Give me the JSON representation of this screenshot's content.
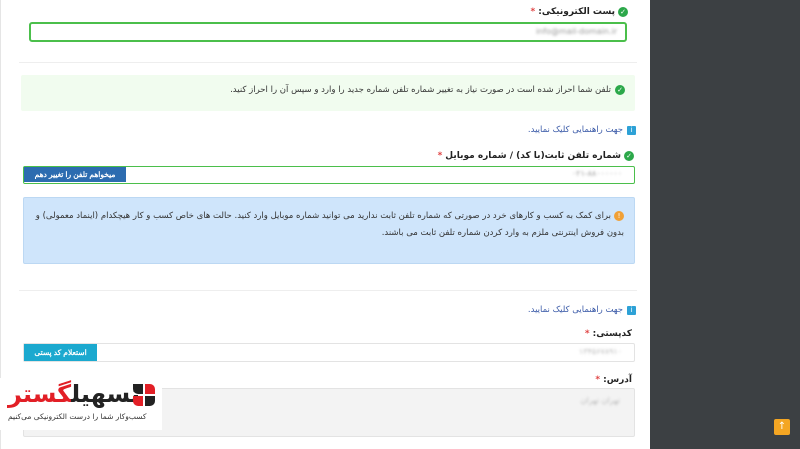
{
  "email": {
    "label": "پست الکترونیکی:",
    "required_mark": "*",
    "value": "info@mail-domain.ir"
  },
  "verified_alert": {
    "text": "تلفن شما احراز شده است در صورت نیاز به تغییر شماره تلفن شماره جدید را وارد و سپس آن را احراز کنید."
  },
  "guide_link_1": "جهت راهنمایی کلیک نمایید.",
  "phone": {
    "label": "شماره تلفن ثابت(با کد) / شماره موبایل",
    "required_mark": "*",
    "value": "۰۲۱-۸۸۰۰۰۰۰۰",
    "button": "میخواهم تلفن را تغییر دهم"
  },
  "info_alert": {
    "line1": "برای کمک به کسب و کارهای خرد در صورتی که شماره تلفن ثابت ندارید می توانید شماره موبایل وارد کنید. حالت های خاص کسب و کار هیچکدام (اینماد معمولی) و",
    "line2": "بدون فروش اینترنتی ملزم به وارد کردن شماره تلفن ثابت می باشند."
  },
  "guide_link_2": "جهت راهنمایی کلیک نمایید.",
  "postal": {
    "label": "کدپستی:",
    "required_mark": "*",
    "value": "۱۳۴۵۶۷۸۹۱۰",
    "button": "استعلام کد پستی"
  },
  "address": {
    "label": "آدرس:",
    "required_mark": "*",
    "value": "تهران تهران"
  },
  "logo": {
    "part_red": "گستر",
    "part_dark": "تسهیل",
    "tagline": "کسب‌وکار شما را درست الکترونیکی می‌کنیم"
  },
  "icons": {
    "check": "check-circle-icon",
    "info": "info-icon",
    "warning": "exclamation-icon",
    "scroll": "arrow-up-icon"
  },
  "colors": {
    "success_border": "#4bbf4b",
    "primary_button": "#2c6cb0",
    "info_button": "#1ba9cf",
    "info_alert_bg": "#cfe5fb",
    "success_alert_bg": "#f1fcef",
    "side_panel": "#3c4043",
    "scroll_button": "#f4a623",
    "brand_red": "#e21f26"
  }
}
